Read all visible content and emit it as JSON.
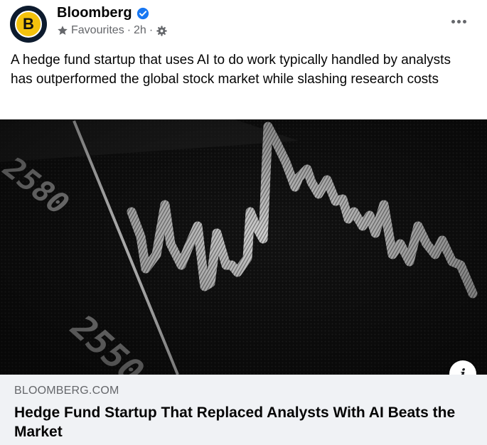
{
  "post": {
    "page_name": "Bloomberg",
    "avatar_letter": "B",
    "audience": "Favourites",
    "time": "2h",
    "separator": "·",
    "text": "A hedge fund startup that uses AI to do work typically handled by analysts has outperformed the global stock market while slashing research costs"
  },
  "image": {
    "ticker_labels": [
      "2580",
      "2550"
    ]
  },
  "link": {
    "domain": "BLOOMBERG.COM",
    "title": "Hedge Fund Startup That Replaced Analysts With AI Beats the Market",
    "info_symbol": "i"
  },
  "icons": {
    "verified": "verified-badge-icon",
    "audience": "star-icon",
    "settings": "gear-icon",
    "more": "more-options-icon",
    "info": "info-icon"
  },
  "colors": {
    "verified": "#1877f2",
    "avatar_ring": "#0d1b2e",
    "avatar_fill": "#f4c20d",
    "link_card_bg": "#f0f2f5",
    "secondary_text": "#65676b"
  }
}
